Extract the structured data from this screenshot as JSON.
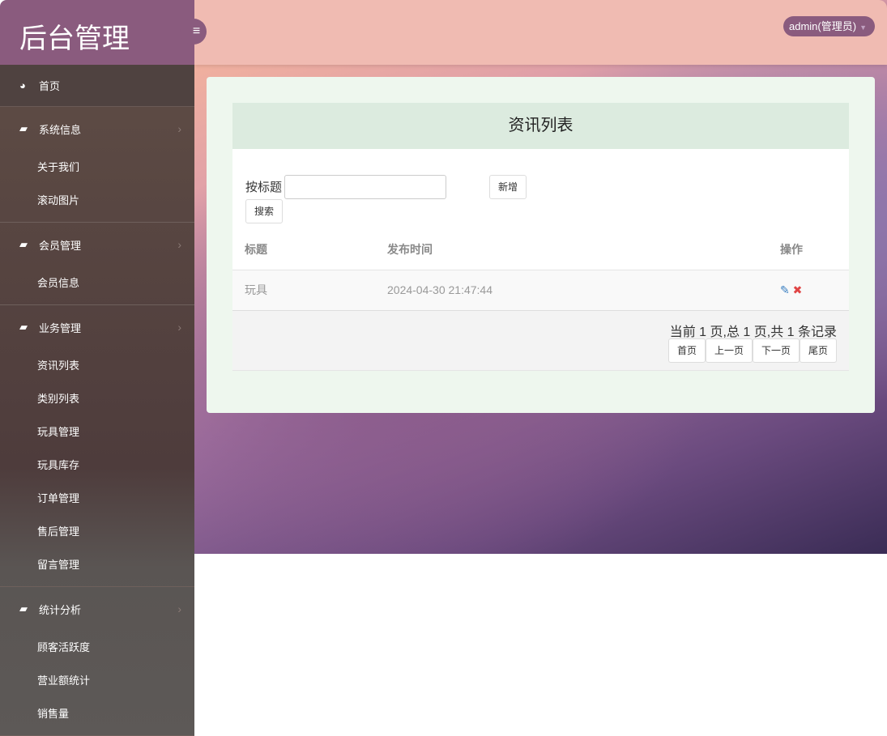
{
  "header": {
    "title": "后台管理",
    "user": "admin(管理员)"
  },
  "sidebar": {
    "home": "首页",
    "groups": [
      {
        "label": "系统信息",
        "items": [
          "关于我们",
          "滚动图片"
        ]
      },
      {
        "label": "会员管理",
        "items": [
          "会员信息"
        ]
      },
      {
        "label": "业务管理",
        "items": [
          "资讯列表",
          "类别列表",
          "玩具管理",
          "玩具库存",
          "订单管理",
          "售后管理",
          "留言管理"
        ]
      },
      {
        "label": "统计分析",
        "items": [
          "顾客活跃度",
          "营业额统计",
          "销售量"
        ]
      }
    ]
  },
  "main": {
    "title": "资讯列表",
    "search_label": "按标题",
    "search_value": "",
    "add": "新增",
    "search": "搜索",
    "columns": [
      "标题",
      "发布时间",
      "操作"
    ],
    "rows": [
      {
        "title": "玩具",
        "time": "2024-04-30 21:47:44"
      }
    ],
    "pagination": {
      "info": "当前 1 页,总 1 页,共 1 条记录",
      "first": "首页",
      "prev": "上一页",
      "next": "下一页",
      "last": "尾页"
    }
  }
}
